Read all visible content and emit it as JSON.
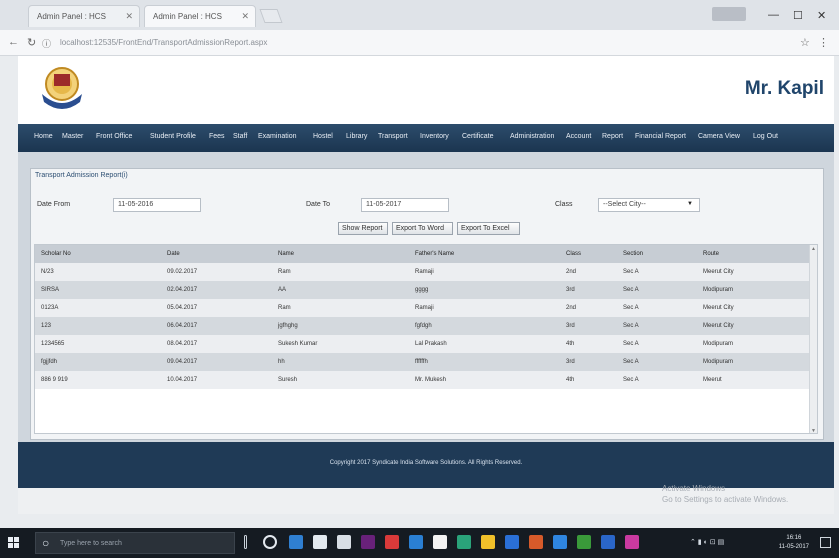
{
  "browser": {
    "tabs": [
      {
        "title": "Admin Panel : HCS"
      },
      {
        "title": "Admin Panel : HCS"
      }
    ],
    "url": "localhost:12535/FrontEnd/TransportAdmissionReport.aspx"
  },
  "header": {
    "user_name": "Mr. Kapil"
  },
  "nav": {
    "items": [
      "Home",
      "Master",
      "Front Office",
      "Student Profile",
      "Fees",
      "Staff",
      "Examination",
      "Hostel",
      "Library",
      "Transport",
      "Inventory",
      "Certificate",
      "Administration",
      "Account",
      "Report",
      "Financial Report",
      "Camera View",
      "Log Out"
    ]
  },
  "form": {
    "title": "Transport Admission Report(i)",
    "date_from_label": "Date From",
    "date_from_value": "11-05-2016",
    "date_to_label": "Date To",
    "date_to_value": "11-05-2017",
    "class_label": "Class",
    "class_value": "--Select City--",
    "buttons": {
      "show": "Show Report",
      "export_word": "Export To Word",
      "export_excel": "Export To Excel"
    }
  },
  "grid": {
    "columns": [
      "Scholar No",
      "Date",
      "Name",
      "Father's Name",
      "Class",
      "Section",
      "Route"
    ],
    "rows": [
      [
        "N/23",
        "09.02.2017",
        "Ram",
        "Ramaji",
        "2nd",
        "Sec A",
        "Meerut City"
      ],
      [
        "SIRSA",
        "02.04.2017",
        "AA",
        "gggg",
        "3rd",
        "Sec A",
        "Modipuram"
      ],
      [
        "0123A",
        "05.04.2017",
        "Ram",
        "Ramaji",
        "2nd",
        "Sec A",
        "Meerut City"
      ],
      [
        "123",
        "06.04.2017",
        "jgfhghg",
        "fgfdgh",
        "3rd",
        "Sec A",
        "Meerut City"
      ],
      [
        "1234565",
        "08.04.2017",
        "Sukesh Kumar",
        "Lal Prakash",
        "4th",
        "Sec A",
        "Modipuram"
      ],
      [
        "fgjjfdh",
        "09.04.2017",
        "hh",
        "ffffffh",
        "3rd",
        "Sec A",
        "Modipuram"
      ],
      [
        "886 9 919",
        "10.04.2017",
        "Suresh",
        "Mr. Mukesh",
        "4th",
        "Sec A",
        "Meerut"
      ]
    ]
  },
  "footer": {
    "text": "Copyright 2017 Syndicate India Software Solutions. All Rights Reserved."
  },
  "watermark": {
    "line1": "Activate Windows",
    "line2": "Go to Settings to activate Windows."
  },
  "taskbar": {
    "search_placeholder": "Type here to search",
    "time": "16:16",
    "date": "11-05-2017"
  },
  "colors": {
    "nav_bg": "#1f3a56",
    "header_text": "#20456b",
    "grid_header": "#c7cdd4"
  }
}
